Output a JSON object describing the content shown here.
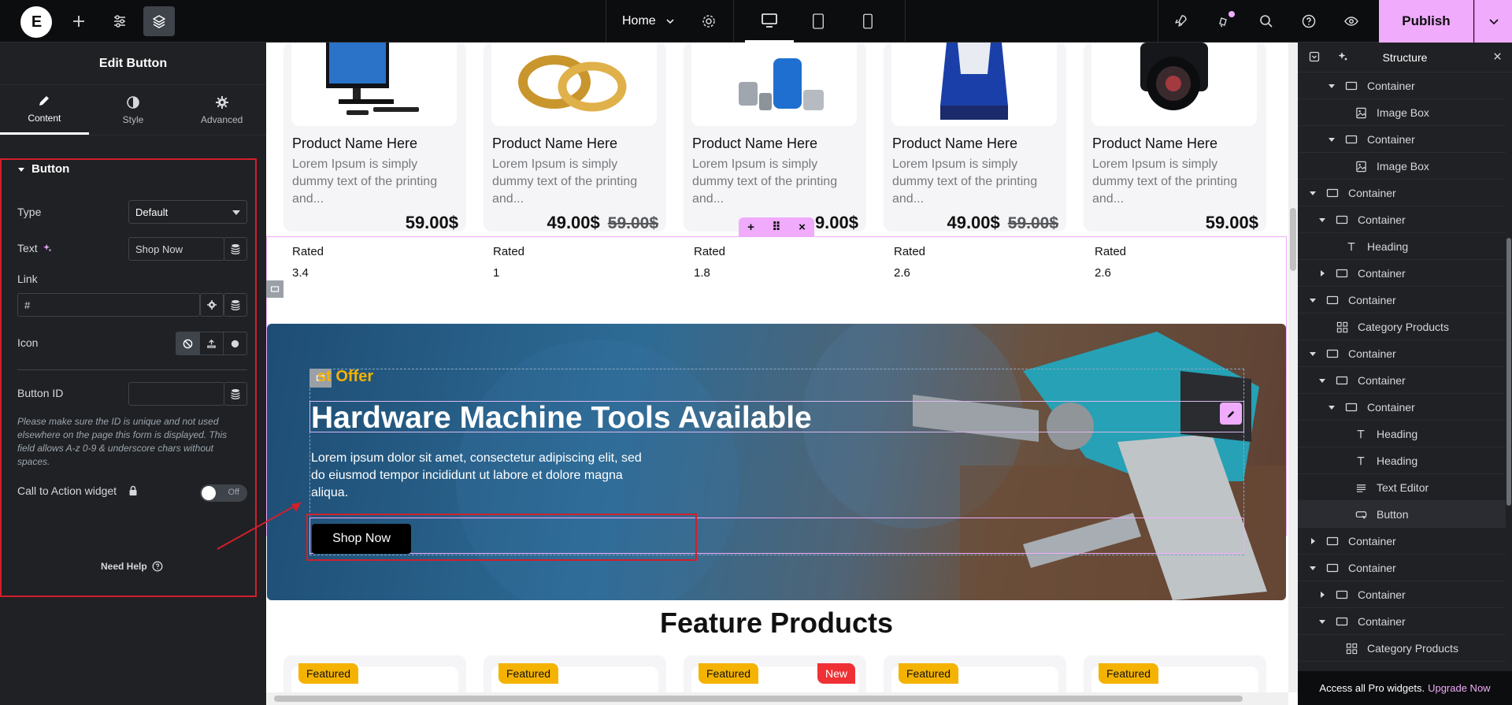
{
  "topbar": {
    "page_name": "Home",
    "publish_label": "Publish",
    "colors": {
      "accent": "#f0abfc",
      "bg": "#0c0d0e"
    }
  },
  "left_panel": {
    "title": "Edit Button",
    "tabs": [
      {
        "label": "Content",
        "icon": "pencil-icon",
        "active": true
      },
      {
        "label": "Style",
        "icon": "contrast-icon",
        "active": false
      },
      {
        "label": "Advanced",
        "icon": "gear-icon",
        "active": false
      }
    ],
    "section_title": "Button",
    "type_label": "Type",
    "type_value": "Default",
    "text_label": "Text",
    "text_value": "Shop Now",
    "link_label": "Link",
    "link_value": "#",
    "icon_label": "Icon",
    "button_id_label": "Button ID",
    "button_id_value": "",
    "note": "Please make sure the ID is unique and not used elsewhere on the page this form is displayed. This field allows A-z  0-9 & underscore chars without spaces.",
    "cta_label": "Call to Action widget",
    "toggle_state": "Off",
    "need_help": "Need Help"
  },
  "canvas": {
    "products": [
      {
        "name": "Product Name Here",
        "desc": "Lorem Ipsum is simply dummy text of the printing and...",
        "price": "59.00$",
        "old_price": "",
        "rated_label": "Rated",
        "rating": "3.4"
      },
      {
        "name": "Product Name Here",
        "desc": "Lorem Ipsum is simply dummy text of the printing and...",
        "price": "49.00$",
        "old_price": "59.00$",
        "rated_label": "Rated",
        "rating": "1"
      },
      {
        "name": "Product Name Here",
        "desc": "Lorem Ipsum is simply dummy text of the printing and...",
        "price": "9.00$",
        "old_price": "",
        "rated_label": "Rated",
        "rating": "1.8"
      },
      {
        "name": "Product Name Here",
        "desc": "Lorem Ipsum is simply dummy text of the printing and...",
        "price": "49.00$",
        "old_price": "59.00$",
        "rated_label": "Rated",
        "rating": "2.6"
      },
      {
        "name": "Product Name Here",
        "desc": "Lorem Ipsum is simply dummy text of the printing and...",
        "price": "59.00$",
        "old_price": "",
        "rated_label": "Rated",
        "rating": "2.6"
      }
    ],
    "banner": {
      "eyebrow": "st Offer",
      "headline": "Hardware Machine Tools Available",
      "text": "Lorem ipsum dolor sit amet, consectetur adipiscing elit, sed do eiusmod tempor incididunt ut labore et dolore magna aliqua.",
      "button": "Shop Now"
    },
    "feature_title": "Feature Products",
    "feature_badges": [
      {
        "label": "Featured",
        "new": ""
      },
      {
        "label": "Featured",
        "new": ""
      },
      {
        "label": "Featured",
        "new": "New"
      },
      {
        "label": "Featured",
        "new": ""
      },
      {
        "label": "Featured",
        "new": ""
      }
    ]
  },
  "right_panel": {
    "title": "Structure",
    "tree": [
      {
        "label": "Container",
        "icon": "container-icon",
        "depth": 2,
        "arrow": "down"
      },
      {
        "label": "Image Box",
        "icon": "image-box-icon",
        "depth": 3,
        "arrow": ""
      },
      {
        "label": "Container",
        "icon": "container-icon",
        "depth": 2,
        "arrow": "down"
      },
      {
        "label": "Image Box",
        "icon": "image-box-icon",
        "depth": 3,
        "arrow": ""
      },
      {
        "label": "Container",
        "icon": "container-icon",
        "depth": 0,
        "arrow": "down"
      },
      {
        "label": "Container",
        "icon": "container-icon",
        "depth": 1,
        "arrow": "down"
      },
      {
        "label": "Heading",
        "icon": "heading-icon",
        "depth": 2,
        "arrow": ""
      },
      {
        "label": "Container",
        "icon": "container-icon",
        "depth": 1,
        "arrow": "right"
      },
      {
        "label": "Container",
        "icon": "container-icon",
        "depth": 0,
        "arrow": "down"
      },
      {
        "label": "Category Products",
        "icon": "grid-icon",
        "depth": 1,
        "arrow": ""
      },
      {
        "label": "Container",
        "icon": "container-icon",
        "depth": 0,
        "arrow": "down"
      },
      {
        "label": "Container",
        "icon": "container-icon",
        "depth": 1,
        "arrow": "down"
      },
      {
        "label": "Container",
        "icon": "container-icon",
        "depth": 2,
        "arrow": "down"
      },
      {
        "label": "Heading",
        "icon": "heading-icon",
        "depth": 3,
        "arrow": ""
      },
      {
        "label": "Heading",
        "icon": "heading-icon",
        "depth": 3,
        "arrow": ""
      },
      {
        "label": "Text Editor",
        "icon": "text-editor-icon",
        "depth": 3,
        "arrow": ""
      },
      {
        "label": "Button",
        "icon": "button-icon",
        "depth": 3,
        "arrow": "",
        "active": true
      },
      {
        "label": "Container",
        "icon": "container-icon",
        "depth": 0,
        "arrow": "right"
      },
      {
        "label": "Container",
        "icon": "container-icon",
        "depth": 0,
        "arrow": "down"
      },
      {
        "label": "Container",
        "icon": "container-icon",
        "depth": 1,
        "arrow": "right"
      },
      {
        "label": "Container",
        "icon": "container-icon",
        "depth": 1,
        "arrow": "down"
      },
      {
        "label": "Category Products",
        "icon": "grid-icon",
        "depth": 2,
        "arrow": ""
      }
    ],
    "footer_text": "Access all Pro widgets.",
    "footer_link": "Upgrade Now"
  }
}
